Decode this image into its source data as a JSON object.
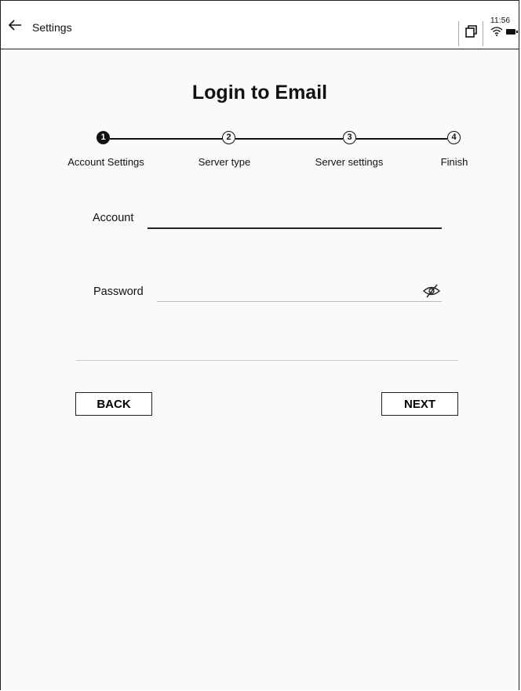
{
  "topbar": {
    "title": "Settings",
    "time": "11:56"
  },
  "page": {
    "heading": "Login to Email"
  },
  "steps": [
    {
      "number": "1",
      "label": "Account Settings",
      "active": true
    },
    {
      "number": "2",
      "label": "Server type",
      "active": false
    },
    {
      "number": "3",
      "label": "Server settings",
      "active": false
    },
    {
      "number": "4",
      "label": "Finish",
      "active": false
    }
  ],
  "form": {
    "account_label": "Account",
    "account_value": "",
    "password_label": "Password",
    "password_value": ""
  },
  "buttons": {
    "back": "BACK",
    "next": "NEXT"
  },
  "icons": {
    "back": "back-arrow-icon",
    "window": "window-icon",
    "wifi": "wifi-icon",
    "battery": "battery-icon",
    "password_visibility": "eye-off-icon"
  }
}
